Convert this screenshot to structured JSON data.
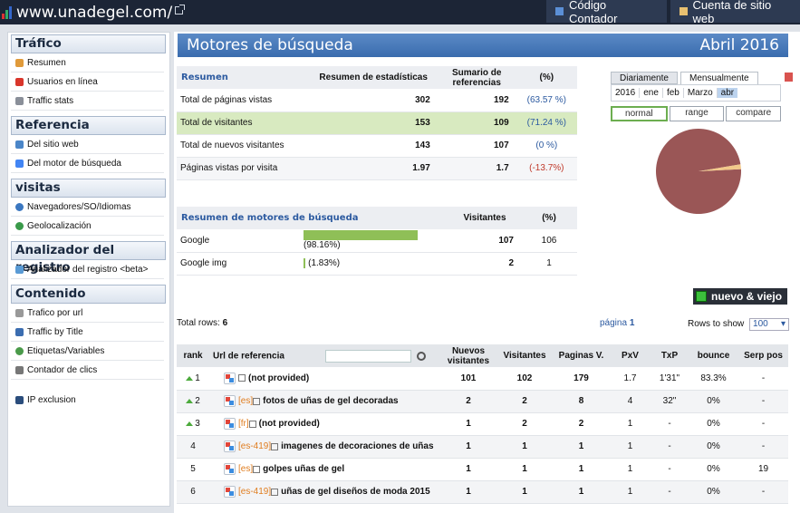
{
  "top": {
    "site": "www.unadegel.com/",
    "btn1": "Código Contador",
    "btn2": "Cuenta de sitio web"
  },
  "sidebar": {
    "sections": [
      {
        "title": "Tráfico",
        "items": [
          "Resumen",
          "Usuarios en línea",
          "Traffic stats"
        ]
      },
      {
        "title": "Referencia",
        "items": [
          "Del sitio web",
          "Del motor de búsqueda"
        ]
      },
      {
        "title": "visitas",
        "items": [
          "Navegadores/SO/Idiomas",
          "Geolocalización"
        ]
      },
      {
        "title": "Analizador del registro",
        "items": [
          "Analizador del registro <beta>"
        ]
      },
      {
        "title": "Contenido",
        "items": [
          "Trafico por url",
          "Traffic by Title",
          "Etiquetas/Variables",
          "Contador de clics"
        ]
      }
    ],
    "extra": "IP exclusion"
  },
  "header": {
    "title": "Motores de búsqueda",
    "period": "Abril 2016"
  },
  "resumen": {
    "title": "Resumen",
    "col1": "Resumen de estadísticas",
    "col2": "Sumario de referencias",
    "col3": "(%)",
    "rows": [
      {
        "label": "Total de páginas vistas",
        "v1": "302",
        "v2": "192",
        "pct": "(63.57 %)"
      },
      {
        "label": "Total de visitantes",
        "v1": "153",
        "v2": "109",
        "pct": "(71.24 %)"
      },
      {
        "label": "Total de nuevos visitantes",
        "v1": "143",
        "v2": "107",
        "pct": "(0 %)"
      },
      {
        "label": "Páginas vistas por visita",
        "v1": "1.97",
        "v2": "1.7",
        "pct": "(-13.7%)"
      }
    ]
  },
  "motores": {
    "title": "Resumen de motores de búsqueda",
    "col1": "Visitantes",
    "col2": "(%)",
    "rows": [
      {
        "label": "Google",
        "bar_pct": 98.16,
        "pct": "(98.16%)",
        "v": "107",
        "n": "106"
      },
      {
        "label": "Google img",
        "bar_pct": 1.83,
        "pct": "(1.83%)",
        "v": "2",
        "n": "1"
      }
    ]
  },
  "calendar": {
    "tab1": "Diariamente",
    "tab2": "Mensualmente",
    "year": "2016",
    "months": [
      "ene",
      "feb",
      "Marzo",
      "abr"
    ],
    "btns": [
      "normal",
      "range",
      "compare"
    ]
  },
  "pie": {
    "slices": [
      {
        "value": 98.16,
        "color": "#9a5656"
      },
      {
        "value": 1.83,
        "color": "#f2c98a"
      }
    ]
  },
  "nv": "nuevo & viejo",
  "meta": {
    "total_label": "Total rows:",
    "total": "6",
    "page_label": "página",
    "page": "1",
    "rows_label": "Rows to show",
    "rows_value": "100"
  },
  "table": {
    "headers": [
      "rank",
      "Url de referencia",
      "Nuevos visitantes",
      "Visitantes",
      "Paginas V.",
      "PxV",
      "TxP",
      "bounce",
      "Serp pos"
    ],
    "rows": [
      {
        "rank": "1",
        "lang": "",
        "text": "(not provided)",
        "nuevos": "101",
        "vis": "102",
        "pag": "179",
        "pxv": "1.7",
        "txp": "1'31\"",
        "bounce": "83.3%",
        "serp": "-"
      },
      {
        "rank": "2",
        "lang": "[es]",
        "text": "fotos de uñas de gel decoradas",
        "nuevos": "2",
        "vis": "2",
        "pag": "8",
        "pxv": "4",
        "txp": "32\"",
        "bounce": "0%",
        "serp": "-"
      },
      {
        "rank": "3",
        "lang": "[fr]",
        "text": "(not provided)",
        "nuevos": "1",
        "vis": "2",
        "pag": "2",
        "pxv": "1",
        "txp": "-",
        "bounce": "0%",
        "serp": "-"
      },
      {
        "rank": "4",
        "lang": "[es-419]",
        "text": "imagenes de decoraciones de uñas",
        "nuevos": "1",
        "vis": "1",
        "pag": "1",
        "pxv": "1",
        "txp": "-",
        "bounce": "0%",
        "serp": "-"
      },
      {
        "rank": "5",
        "lang": "[es]",
        "text": "golpes uñas de gel",
        "nuevos": "1",
        "vis": "1",
        "pag": "1",
        "pxv": "1",
        "txp": "-",
        "bounce": "0%",
        "serp": "19"
      },
      {
        "rank": "6",
        "lang": "[es-419]",
        "text": "uñas de gel diseños de moda 2015",
        "nuevos": "1",
        "vis": "1",
        "pag": "1",
        "pxv": "1",
        "txp": "-",
        "bounce": "0%",
        "serp": "-"
      }
    ]
  }
}
